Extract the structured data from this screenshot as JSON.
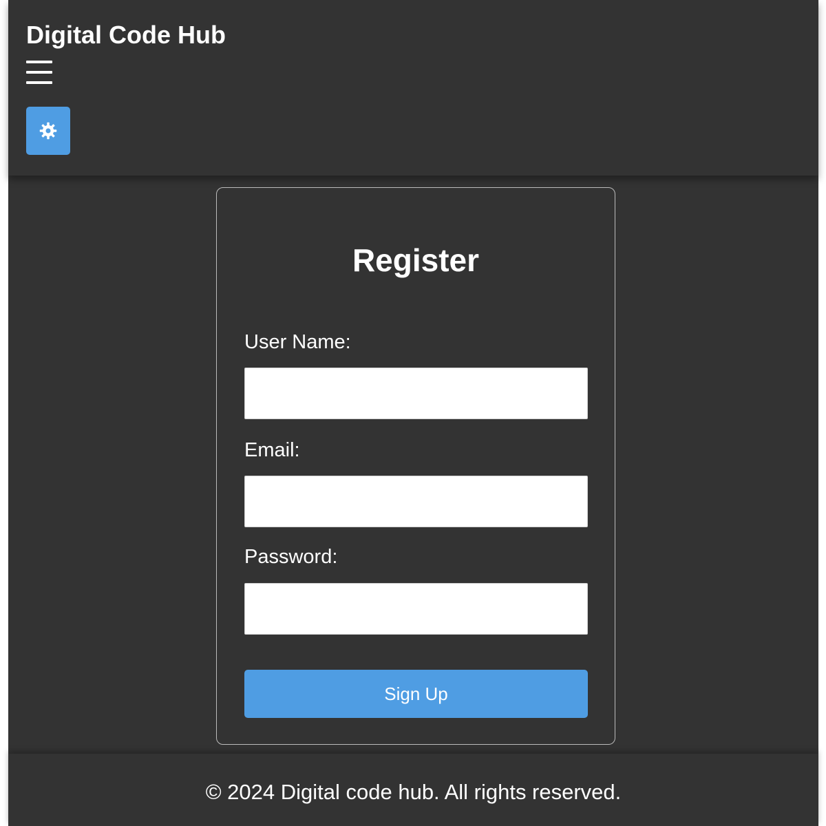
{
  "header": {
    "title": "Digital Code Hub",
    "menu_icon": "hamburger-menu-icon",
    "theme_icon": "gear-icon",
    "accent_color": "#4f9de3"
  },
  "form": {
    "heading": "Register",
    "username_label": "User Name:",
    "username_value": "",
    "email_label": "Email:",
    "email_value": "",
    "password_label": "Password:",
    "password_value": "",
    "submit_label": "Sign Up"
  },
  "footer": {
    "text": "© 2024 Digital code hub. All rights reserved."
  }
}
